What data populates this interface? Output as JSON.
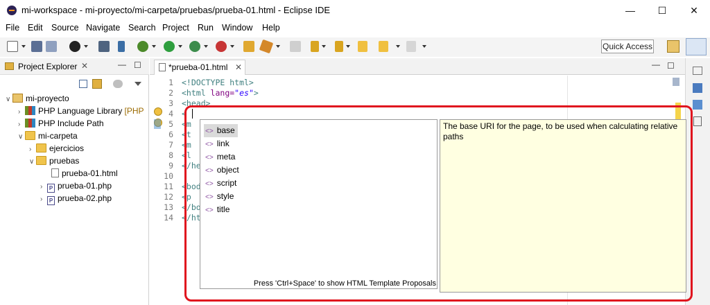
{
  "window": {
    "title": "mi-workspace - mi-proyecto/mi-carpeta/pruebas/prueba-01.html - Eclipse IDE"
  },
  "menu": [
    "File",
    "Edit",
    "Source",
    "Navigate",
    "Search",
    "Project",
    "Run",
    "Window",
    "Help"
  ],
  "toolbar": {
    "quick_access": "Quick Access"
  },
  "project_explorer": {
    "title": "Project Explorer",
    "tree": [
      {
        "label": "mi-proyecto"
      },
      {
        "label": "PHP Language Library",
        "suffix": "[PHP"
      },
      {
        "label": "PHP Include Path"
      },
      {
        "label": "mi-carpeta"
      },
      {
        "label": "ejercicios"
      },
      {
        "label": "pruebas"
      },
      {
        "label": "prueba-01.html"
      },
      {
        "label": "prueba-01.php"
      },
      {
        "label": "prueba-02.php"
      }
    ]
  },
  "editor": {
    "tab": "*prueba-01.html",
    "lines": [
      "1",
      "2",
      "3",
      "4",
      "5",
      "6",
      "7",
      "8",
      "9",
      "10",
      "11",
      "12",
      "13",
      "14"
    ],
    "code": {
      "l1": "<!DOCTYPE html>",
      "l2a": "<html ",
      "l2b": "lang=",
      "l2c": "\"es\"",
      "l2d": ">",
      "l3": "<head>",
      "l4": "<",
      "l5": "<m",
      "l6": "<t",
      "l7": "<m",
      "l8": "<l",
      "l9": "</he",
      "l11": "<bod",
      "l12": "<p",
      "l13": "</bo",
      "l14": "</ht"
    }
  },
  "content_assist": {
    "proposals": [
      "base",
      "link",
      "meta",
      "object",
      "script",
      "style",
      "title"
    ],
    "selected": "base",
    "footer": "Press 'Ctrl+Space' to show HTML Template Proposals",
    "info": "The base URI for the page, to be used when calculating relative paths"
  }
}
